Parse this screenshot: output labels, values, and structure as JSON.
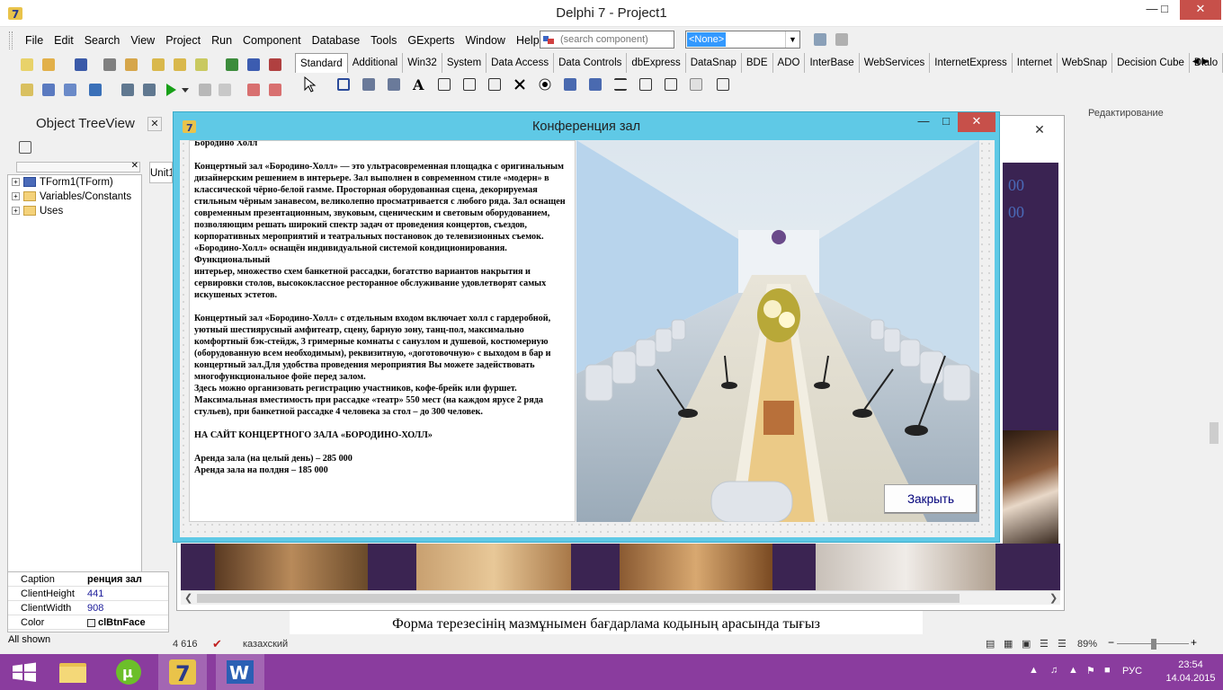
{
  "ide": {
    "title": "Delphi 7 - Project1",
    "menu": [
      "File",
      "Edit",
      "Search",
      "View",
      "Project",
      "Run",
      "Component",
      "Database",
      "Tools",
      "GExperts",
      "Window",
      "Help"
    ],
    "search_placeholder": "(search component)",
    "none_value": "<None>",
    "palette_tabs": [
      "Standard",
      "Additional",
      "Win32",
      "System",
      "Data Access",
      "Data Controls",
      "dbExpress",
      "DataSnap",
      "BDE",
      "ADO",
      "InterBase",
      "WebServices",
      "InternetExpress",
      "Internet",
      "WebSnap",
      "Decision Cube",
      "Dialo"
    ],
    "section_label": "Редактирование",
    "unit_tab": "Unit1"
  },
  "treeview": {
    "title": "Object TreeView",
    "items": [
      "TForm1(TForm)",
      "Variables/Constants",
      "Uses"
    ]
  },
  "inspector": {
    "rows": [
      {
        "key": "Caption",
        "value": "ренция зал"
      },
      {
        "key": "ClientHeight",
        "value": "441"
      },
      {
        "key": "ClientWidth",
        "value": "908"
      },
      {
        "key": "Color",
        "value": "clBtnFace"
      }
    ],
    "footer": "All shown"
  },
  "dialog": {
    "title": "Конференция зал",
    "memo_text": "Бородино Холл\n\nКонцертный зал «Бородино-Холл» — это ультрасовременная площадка с оригинальным дизайнерским решением  в интерьере. Зал выполнен в современном стиле «модерн» в классической чёрно-белой гамме.  Просторная оборудованная сцена, декорируемая стильным чёрным занавесом, великолепно просматривается с любого ряда. Зал оснащен современным презентационным, звуковым, сценическим и световым оборудованием, позволяющим решать широкий спектр задач от проведения концертов, съездов, корпоративных мероприятий и театральных постановок до телевизионных съемок. «Бородино-Холл» оснащён индивидуальной системой кондиционирования.\nФункциональный\nинтерьер, множество схем банкетной рассадки, богатство вариантов накрытия и\nсервировки столов, высококлассное ресторанное обслуживание  удовлетворят самых искушеных эстетов.\n\nКонцертный зал «Бородино-Холл» с отдельным входом включает холл с гардеробной, уютный шестиярусный амфитеатр, сцену, барную зону, танц-пол, максимально комфортный бэк-стейдж, 3 гримерные комнаты с  санузлом и душевой, костюмерную (оборудованную всем необходимым), реквизитную, «доготовочную» с выходом в бар и концертный зал.Для удобства проведения мероприятия Вы можете задействовать многофункциональное фойе перед залом.\nЗдесь можно организовать регистрацию участников, кофе-брейк или фуршет.\nМаксимальная вместимость при рассадке «театр» 550 мест (на каждом ярусе 2 ряда стульев), при банкетной рассадке 4 человека за стол – до 300 человек.\n\nНА САЙТ КОНЦЕРТНОГО ЗАЛА «БОРОДИНО-ХОЛЛ»\n\nАренда зала (на целый день) – 285 000\nАренда зала на полдня – 185 000",
    "close_label": "Закрыть"
  },
  "bg_form": {
    "purple_text": [
      "00",
      "00"
    ]
  },
  "word": {
    "doc_line": "Форма терезесінің мазмұнымен бағдарлама кодының арасында тығыз",
    "status_words": "4 616",
    "status_lang": "казахский",
    "zoom": "89%"
  },
  "taskbar": {
    "lang": "РУС",
    "time": "23:54",
    "date": "14.04.2015"
  },
  "colors": {
    "dialog_frame": "#5fc9e6",
    "close_red": "#c7504a",
    "taskbar": "#8a3c9e",
    "purple_bg": "#3a2352",
    "button_text": "#00007a"
  }
}
